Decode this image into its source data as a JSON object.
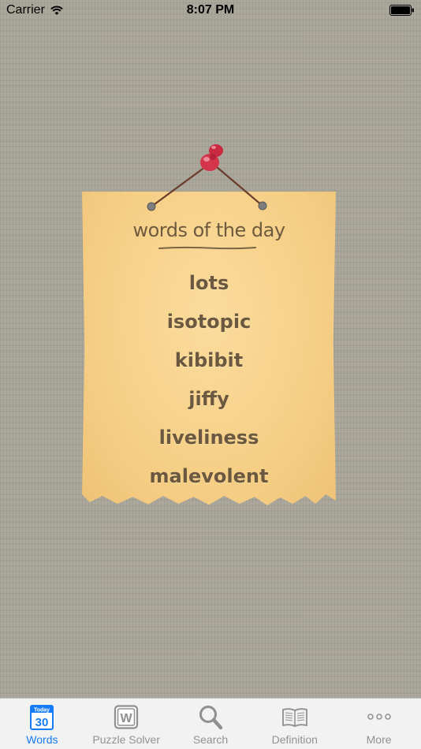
{
  "status_bar": {
    "carrier": "Carrier",
    "time": "8:07 PM"
  },
  "note": {
    "heading": "words of the day",
    "words": [
      "lots",
      "isotopic",
      "kibibit",
      "jiffy",
      "liveliness",
      "malevolent"
    ]
  },
  "calendar_icon": {
    "top": "Today",
    "day": "30"
  },
  "puzzle_icon": {
    "letter": "W"
  },
  "tab_bar": {
    "tabs": [
      {
        "label": "Words",
        "icon": "calendar-icon",
        "active": true
      },
      {
        "label": "Puzzle Solver",
        "icon": "puzzle-w-icon",
        "active": false
      },
      {
        "label": "Search",
        "icon": "search-icon",
        "active": false
      },
      {
        "label": "Definition",
        "icon": "book-icon",
        "active": false
      },
      {
        "label": "More",
        "icon": "more-dots-icon",
        "active": false
      }
    ]
  },
  "colors": {
    "active_tab": "#157cf6",
    "inactive_tab": "#929292",
    "paper": "#f6cf86",
    "ink": "#6b5840",
    "pin": "#d4354b"
  }
}
